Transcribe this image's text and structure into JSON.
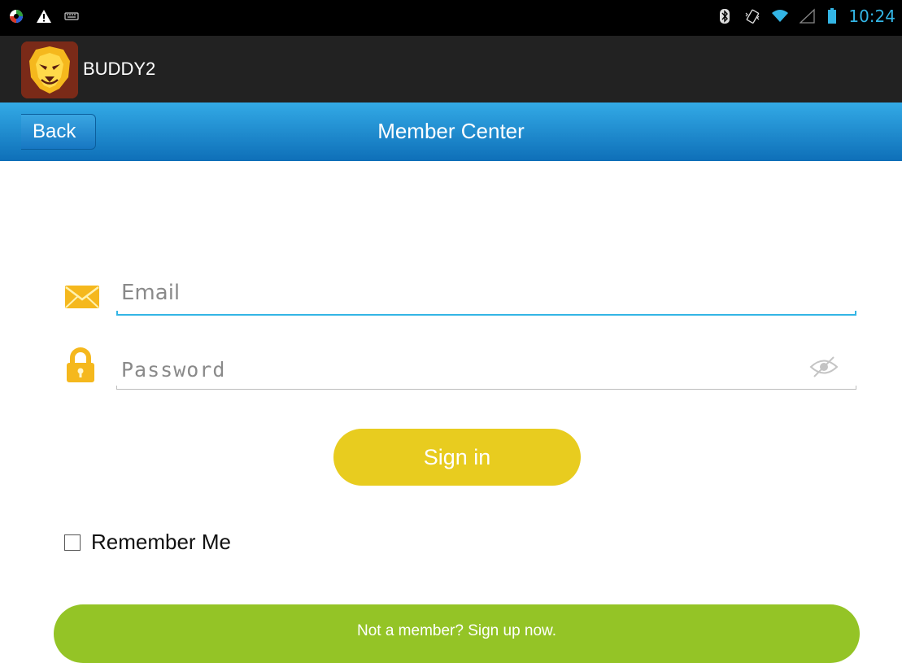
{
  "status_bar": {
    "left_icons": [
      "app-notification-icon",
      "warning-icon",
      "keyboard-icon"
    ],
    "right_icons": [
      "bluetooth-icon",
      "vibrate-icon",
      "wifi-icon",
      "signal-icon",
      "battery-icon"
    ],
    "time": "10:24"
  },
  "app": {
    "title": "BUDDY2",
    "logo_icon": "lion-logo-icon"
  },
  "navbar": {
    "back_label": "Back",
    "title": "Member Center"
  },
  "form": {
    "email": {
      "placeholder": "Email",
      "value": "",
      "icon": "envelope-icon"
    },
    "password": {
      "placeholder": "Password",
      "value": "",
      "icon": "lock-icon",
      "toggle_icon": "eye-hidden-icon"
    },
    "signin_label": "Sign in",
    "remember_label": "Remember Me",
    "remember_checked": false,
    "signup_label": "Not a member? Sign up now."
  },
  "colors": {
    "status_time": "#33b5e5",
    "nav_blue": "#1a86cf",
    "focus_line": "#33b5e5",
    "signin": "#e8cc1f",
    "signup": "#94c426",
    "icon_gold": "#f5b81d"
  }
}
